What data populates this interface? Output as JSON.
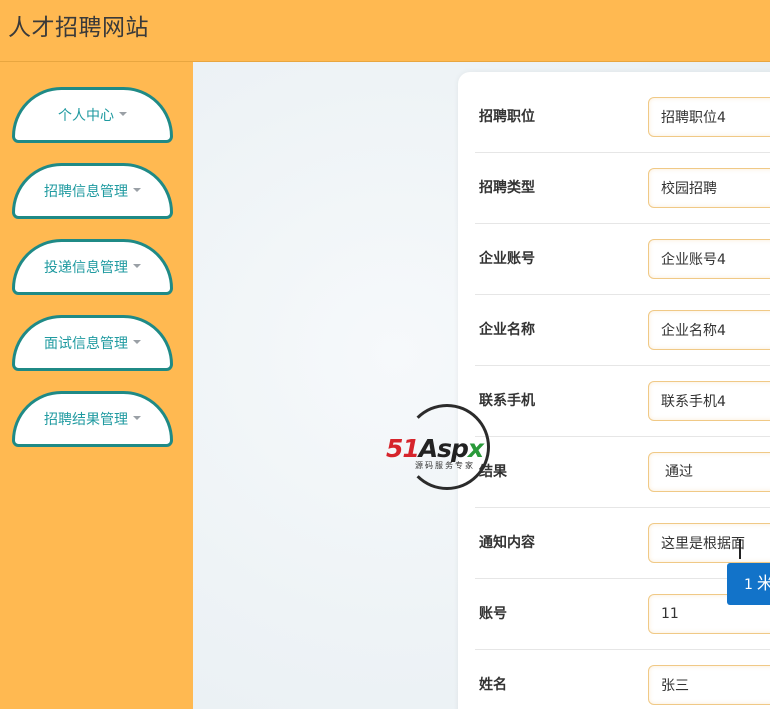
{
  "header": {
    "title": "人才招聘网站"
  },
  "sidebar": {
    "items": [
      {
        "label": "个人中心"
      },
      {
        "label": "招聘信息管理"
      },
      {
        "label": "投递信息管理"
      },
      {
        "label": "面试信息管理"
      },
      {
        "label": "招聘结果管理"
      }
    ]
  },
  "form": {
    "rows": [
      {
        "label": "招聘职位",
        "value": "招聘职位4"
      },
      {
        "label": "招聘类型",
        "value": "校园招聘"
      },
      {
        "label": "企业账号",
        "value": "企业账号4"
      },
      {
        "label": "企业名称",
        "value": "企业名称4"
      },
      {
        "label": "联系手机",
        "value": "联系手机4"
      },
      {
        "label": "结果",
        "value": "通过"
      },
      {
        "label": "通知内容",
        "value": "这里是根据面"
      },
      {
        "label": "账号",
        "value": "11"
      },
      {
        "label": "姓名",
        "value": "张三"
      }
    ]
  },
  "float_button": {
    "small": "1",
    "big": "米"
  },
  "watermark": {
    "brand_red": "51",
    "brand_dark": "Asp",
    "brand_green": "x",
    "tagline": "源码服务专家"
  },
  "colors": {
    "header": "#ffb951",
    "sidebar": "#ffb951",
    "nav_border": "#1f8a86",
    "nav_text": "#1f9aa0",
    "field_border": "#f0c986",
    "float_button": "#1273c9"
  }
}
